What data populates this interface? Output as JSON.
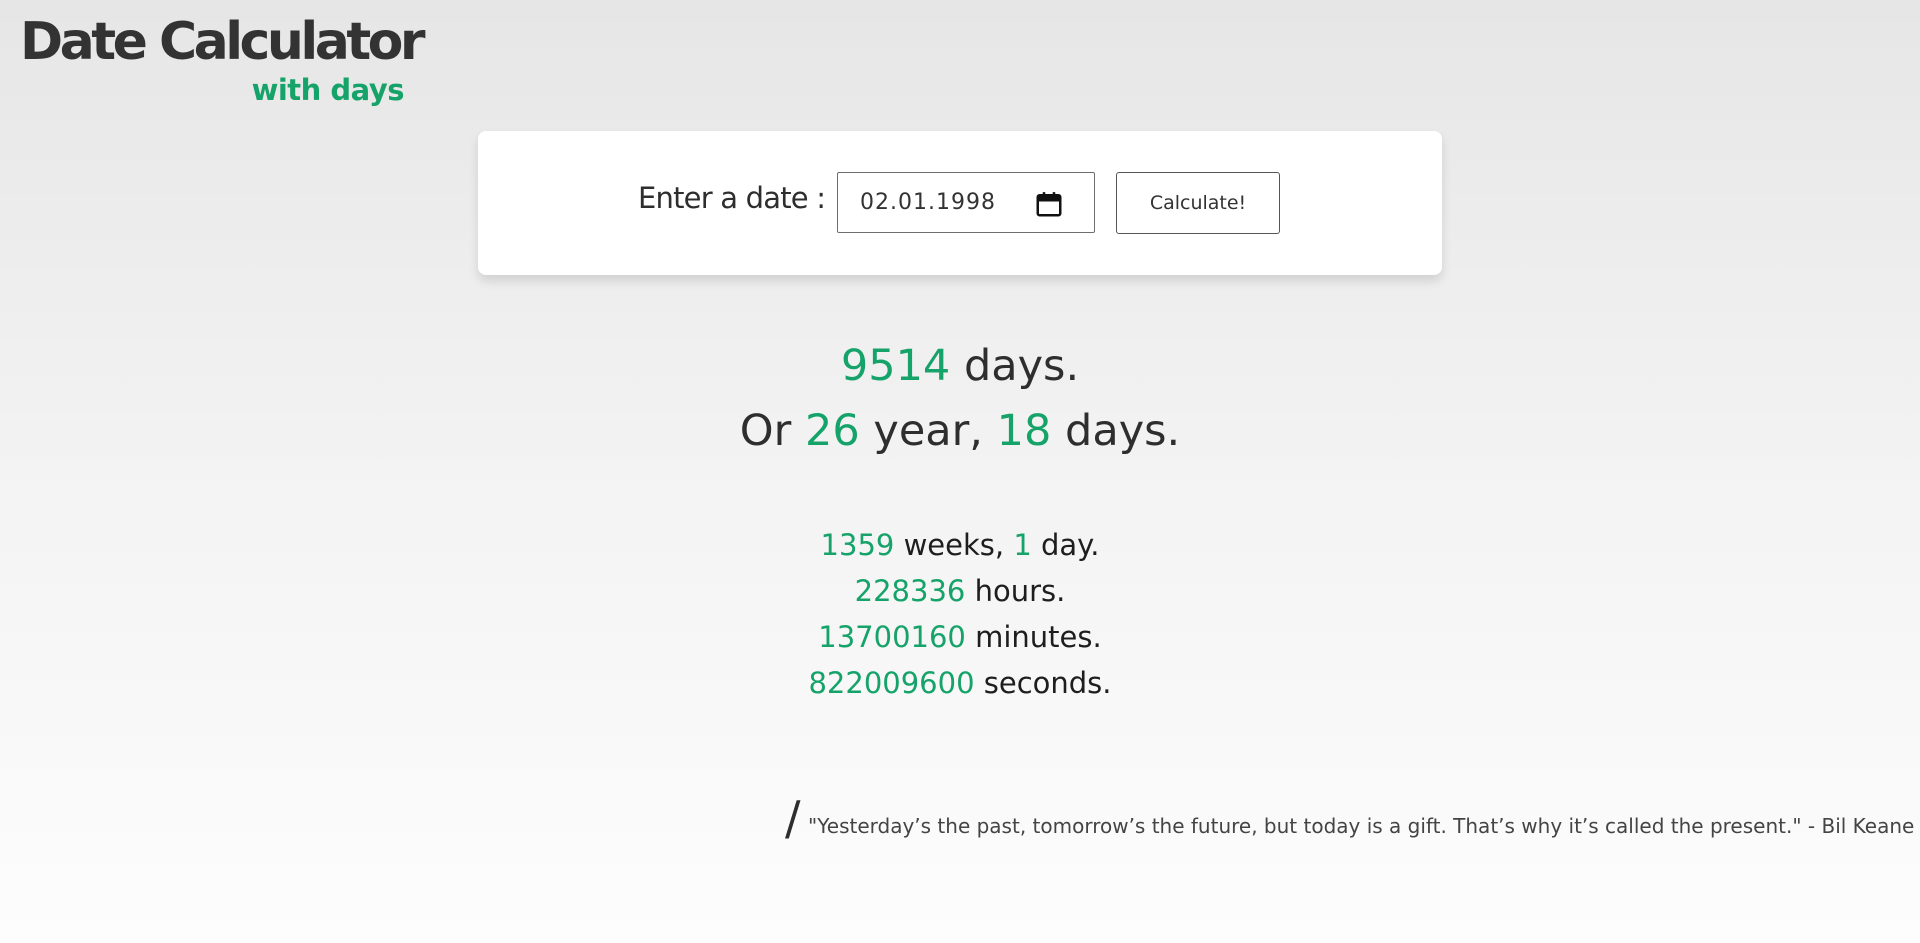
{
  "logo": {
    "title": "Date Calculator",
    "subtitle": "with days"
  },
  "form": {
    "label": "Enter a date :",
    "date_value": "02.01.1998",
    "button_label": "Calculate!"
  },
  "results": {
    "total_days": "9514",
    "total_days_unit": "days.",
    "or_text": "Or",
    "years": "26",
    "years_unit": "year,",
    "rem_days": "18",
    "rem_days_unit": "days.",
    "weeks": "1359",
    "weeks_unit": "weeks,",
    "week_days": "1",
    "week_days_unit": "day.",
    "hours": "228336",
    "hours_unit": "hours.",
    "minutes": "13700160",
    "minutes_unit": "minutes.",
    "seconds": "822009600",
    "seconds_unit": "seconds."
  },
  "quote": {
    "mark": "/",
    "text": "\"Yesterday’s the past, tomorrow’s the future, but today is a gift. That’s why it’s called the present.\" - Bil Keane"
  },
  "colors": {
    "accent": "#16a36a",
    "text": "#2e2e2e"
  },
  "icons": {
    "date_picker": "calendar-icon"
  }
}
